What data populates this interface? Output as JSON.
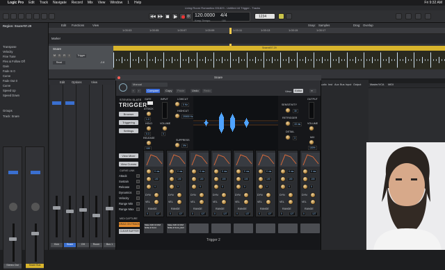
{
  "menubar": {
    "apple": "",
    "items": [
      "Logic Pro",
      "Edit",
      "Track",
      "Navigate",
      "Record",
      "Mix",
      "View",
      "Window",
      "1",
      "Help"
    ],
    "clock": "Fri 9:32 AM"
  },
  "window": {
    "title": "Living Room Romantics 031823 - Untitled 44 Trigger - Tracks"
  },
  "lcd": {
    "tempo": "120.0000",
    "tempo_label": "Keep Tempo",
    "signature": "4/4",
    "division": "/16"
  },
  "lcd_extra": {
    "position": "1234"
  },
  "tracks_toolbar": {
    "region_label": "Region: Snare#07.29",
    "edit": "Edit",
    "functions": "Functions",
    "view": "View",
    "snap_label": "Snap:",
    "snap_value": "Samples",
    "drag_label": "Drag:",
    "drag_value": "Overlap"
  },
  "ruler": {
    "labels": [
      "1:03:03",
      "1:03:05",
      "1:03:07",
      "1:03:09",
      "1:03:11",
      "1:03:13",
      "1:03:15",
      "1:03:17"
    ]
  },
  "marker_label": "Marker",
  "region_name": "Snare#07.29",
  "track": {
    "name": "Snare",
    "mode": "Read",
    "plugin": "Trigger",
    "m": "M",
    "s": "S",
    "r": "R",
    "i": "I",
    "vol": "-2.8"
  },
  "inspector": {
    "lines": [
      "Transpose",
      "Velocity",
      "Fine Tune",
      "Flex & Follow  Off",
      "Gain",
      "Fade In  0",
      "Curve",
      "Fade Out  0",
      "Curve",
      "Speed Up",
      "Speed Down",
      "Track: Snare",
      "Groups"
    ],
    "groups": "Groups",
    "track_label": "Track: Snare"
  },
  "mixer": {
    "edit": "Edit",
    "options": "Options",
    "view": "View",
    "strip_names": [
      "Kick",
      "Snare",
      "OH",
      "Room",
      "Bus 1",
      "Bus 2",
      "Snare Bus"
    ],
    "strip_values": [
      "-1.8",
      "-4.2",
      "-2.0",
      "-6.4",
      "0.0",
      "-0.6",
      "-3.4"
    ],
    "left_strips": [
      "Stereo Out",
      "Snare Bus"
    ],
    "tabs": [
      "Audio",
      "Inst",
      "Aux",
      "Bus",
      "Input",
      "Output",
      "Master/VCA",
      "MIDI"
    ]
  },
  "plugin": {
    "window_title": "Snare",
    "manual": "Manual",
    "nav_compare": "Compare",
    "copy": "Copy",
    "paste": "Paste",
    "undo": "Undo",
    "redo": "Redo",
    "view_label": "View:",
    "view_value": "Editor",
    "brand": "STEVEN SLATE",
    "product": "TRIGGER",
    "browser": "Browser",
    "triggering": "Triggering",
    "settings": "Settings",
    "view_mixer": "View Mixer",
    "view_curves": "View Curves",
    "gate": "GATE",
    "attack": "ATTACK",
    "hold": "HOLD",
    "release": "RELEASE",
    "gate_vals": [
      "1.0",
      "0.3",
      "0",
      "100"
    ],
    "input": "INPUT",
    "volume": "VOLUME",
    "lowcut": "LOWCUT",
    "highcut": "HIGHCUT",
    "suppress": "SUPPRESS",
    "lowcut_val": "0 Hz",
    "highcut_val": "20000 Hz",
    "suppress_val": "0%",
    "sensitivity": "SENSITIVITY",
    "retrigger": "RETRIGGER",
    "detail": "DETAIL",
    "sens_val": "30",
    "retrig_val": "15 ms",
    "detail_val": "3",
    "output": "OUTPUT",
    "mix": "MIX",
    "mix_val": "100%",
    "curve_link": "CURVE LINK",
    "curve_items": [
      "Attack",
      "Sustain",
      "Release",
      "Dynamics",
      "Velocity",
      "Range Min",
      "Range Max"
    ],
    "midi_capture": "MIDI CAPTURE",
    "capture_btn": "DRAG ON TRACK",
    "clear_btn": "CLEAR BUFFER",
    "slot_labels": [
      "DYN",
      "VEL",
      "RANGE"
    ],
    "slot_vals": [
      "0 ms",
      "100",
      "0",
      "127"
    ],
    "slot1_name": "Slate R20 16 DM NOE & 5x14",
    "slot2_name": "Slate R20 16 DM NOE & 5x14_Roll",
    "footer": "Trigger 2"
  }
}
